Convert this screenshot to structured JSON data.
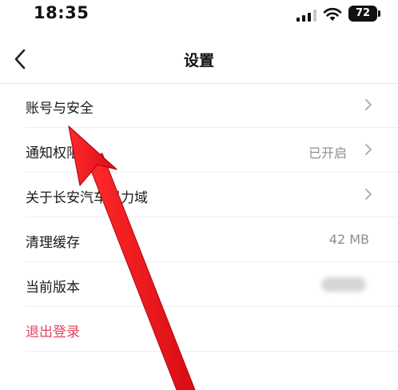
{
  "status_bar": {
    "time": "18:35",
    "battery": "72"
  },
  "nav": {
    "title": "设置"
  },
  "settings": {
    "items": [
      {
        "label": "账号与安全",
        "value": "",
        "chevron": true
      },
      {
        "label": "通知权限",
        "value": "已开启",
        "chevron": true
      },
      {
        "label": "关于长安汽车引力域",
        "value": "",
        "chevron": true
      },
      {
        "label": "清理缓存",
        "value": "42 MB",
        "chevron": false
      },
      {
        "label": "当前版本",
        "value": "",
        "chevron": false
      }
    ],
    "logout_label": "退出登录"
  },
  "colors": {
    "logout": "#e0455e",
    "annotation_arrow": "#f0141e",
    "secondary_text": "#8e8e8e"
  }
}
